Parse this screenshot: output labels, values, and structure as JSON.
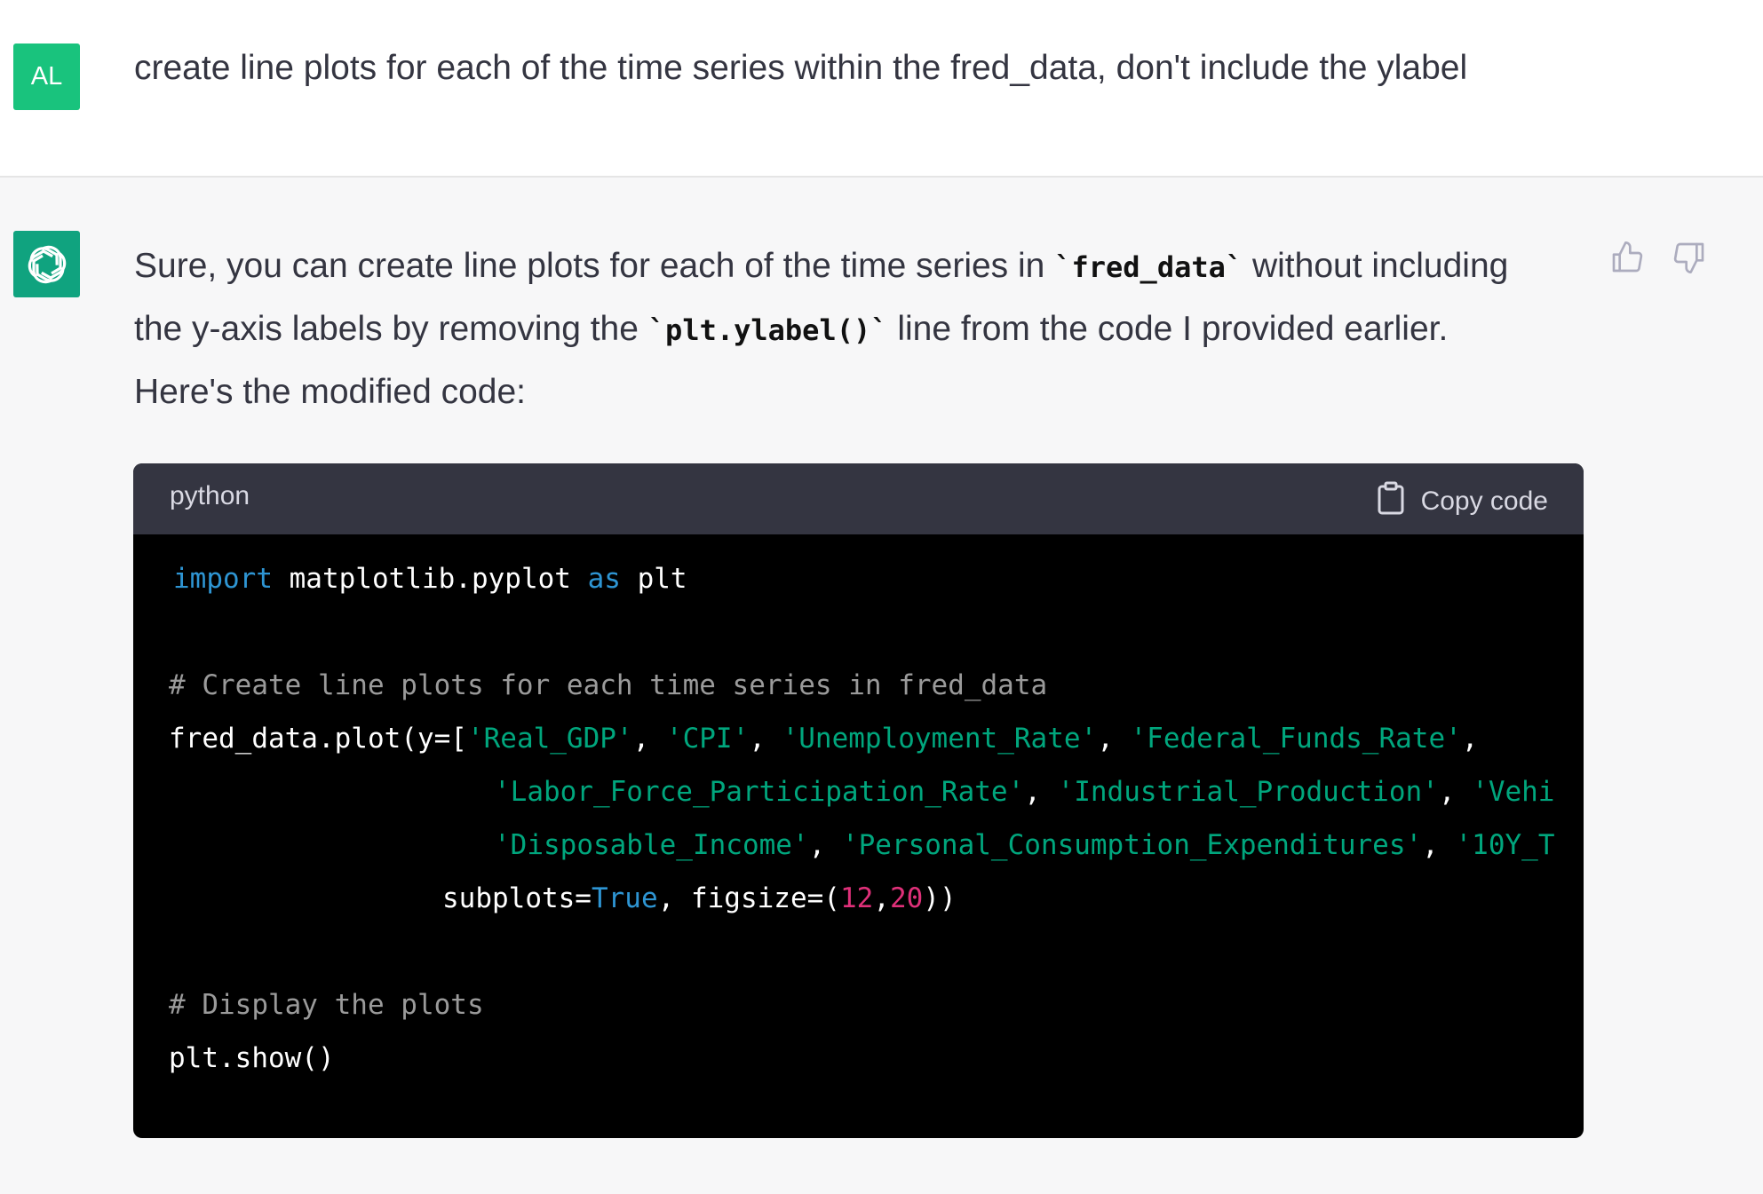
{
  "user": {
    "avatar": "AL",
    "message": "create line plots for each of the time series within the fred_data, don't include the ylabel"
  },
  "assistant": {
    "avatar_icon": "openai-logo-icon",
    "text_part1": "Sure, you can create line plots for each of the time series in ",
    "code_var": "`fred_data`",
    "text_part2": " without including the y-axis labels by removing the ",
    "code_fn": "`plt.ylabel()`",
    "text_part3": " line from the code I provided earlier. Here's the modified code:",
    "feedback": {
      "up_icon": "thumbs-up-icon",
      "down_icon": "thumbs-down-icon"
    }
  },
  "code_block": {
    "language": "python",
    "copy_label": "Copy code",
    "lines": {
      "l1": {
        "kw1": "import",
        "t1": " matplotlib.pyplot ",
        "kw2": "as",
        "t2": " plt"
      },
      "l3": "# Create line plots for each time series in fred_data",
      "l4": {
        "t1": "fred_data.plot(y=[",
        "s1": "'Real_GDP'",
        "c1": ", ",
        "s2": "'CPI'",
        "c2": ", ",
        "s3": "'Unemployment_Rate'",
        "c3": ", ",
        "s4": "'Federal_Funds_Rate'",
        "c4": ","
      },
      "l5": {
        "s1": "'Labor_Force_Participation_Rate'",
        "c1": ", ",
        "s2": "'Industrial_Production'",
        "c2": ", ",
        "s3": "'Vehi"
      },
      "l6": {
        "s1": "'Disposable_Income'",
        "c1": ", ",
        "s2": "'Personal_Consumption_Expenditures'",
        "c2": ", ",
        "s3": "'10Y_T"
      },
      "l7": {
        "t1": "subplots=",
        "kw1": "True",
        "t2": ", figsize=(",
        "n1": "12",
        "t3": ",",
        "n2": "20",
        "t4": "))"
      },
      "l9": "# Display the plots",
      "l10": "plt.show()"
    }
  }
}
